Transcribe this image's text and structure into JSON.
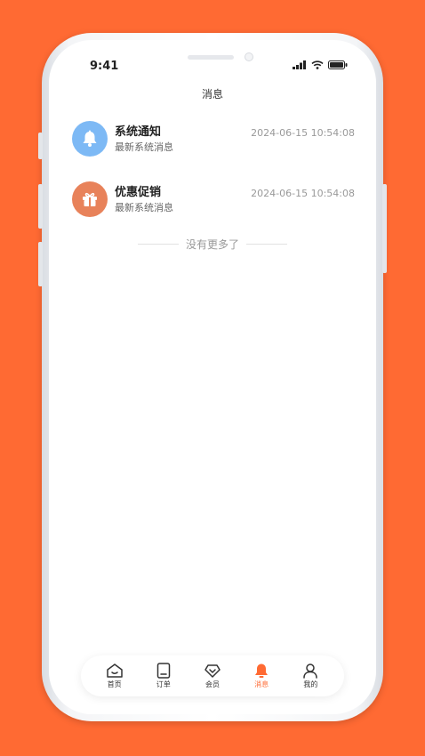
{
  "status": {
    "time": "9:41"
  },
  "header": {
    "title": "消息"
  },
  "messages": [
    {
      "title": "系统通知",
      "subtitle": "最新系统消息",
      "time": "2024-06-15 10:54:08",
      "icon": "bell-icon",
      "color": "#7DB9F5"
    },
    {
      "title": "优惠促销",
      "subtitle": "最新系统消息",
      "time": "2024-06-15 10:54:08",
      "icon": "gift-icon",
      "color": "#E8825A"
    }
  ],
  "footer_text": "没有更多了",
  "tabbar": {
    "active_color": "#FF6A33",
    "items": [
      {
        "label": "首页",
        "icon": "home-icon"
      },
      {
        "label": "订单",
        "icon": "order-icon"
      },
      {
        "label": "会员",
        "icon": "member-icon"
      },
      {
        "label": "消息",
        "icon": "bell-icon",
        "active": true
      },
      {
        "label": "我的",
        "icon": "profile-icon"
      }
    ]
  }
}
